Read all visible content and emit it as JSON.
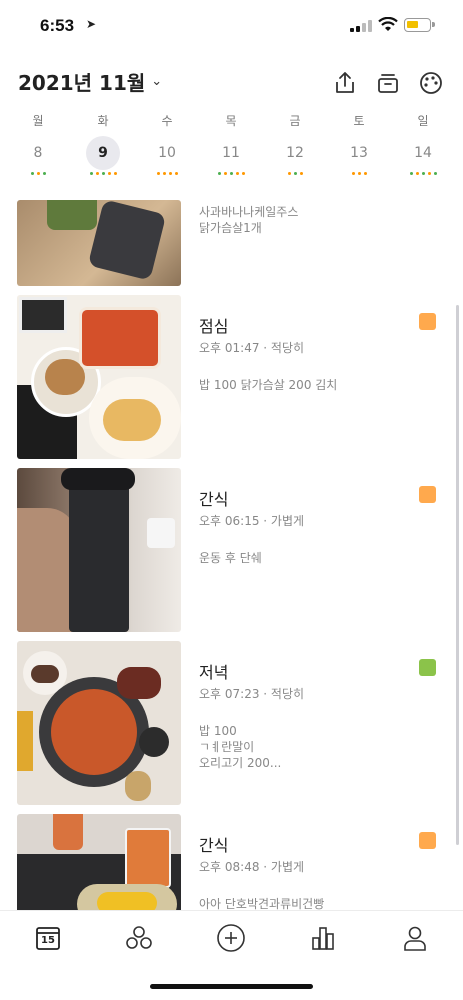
{
  "status_bar": {
    "time": "6:53",
    "battery_color": "#f2c000"
  },
  "header": {
    "month_label": "2021년 11월"
  },
  "week": [
    {
      "weekday": "월",
      "date": "8",
      "selected": false,
      "dots": [
        "#4caf50",
        "#ff9800",
        "#4caf50"
      ]
    },
    {
      "weekday": "화",
      "date": "9",
      "selected": true,
      "dots": [
        "#4caf50",
        "#ff9800",
        "#4caf50",
        "#ff9800",
        "#ff9800"
      ]
    },
    {
      "weekday": "수",
      "date": "10",
      "selected": false,
      "dots": [
        "#ff9800",
        "#ff9800",
        "#ff9800",
        "#ff9800"
      ]
    },
    {
      "weekday": "목",
      "date": "11",
      "selected": false,
      "dots": [
        "#4caf50",
        "#ff9800",
        "#4caf50",
        "#ff9800",
        "#ff9800"
      ]
    },
    {
      "weekday": "금",
      "date": "12",
      "selected": false,
      "dots": [
        "#ff9800",
        "#4caf50",
        "#ff9800"
      ]
    },
    {
      "weekday": "토",
      "date": "13",
      "selected": false,
      "dots": [
        "#ff9800",
        "#ff9800",
        "#ff9800"
      ]
    },
    {
      "weekday": "일",
      "date": "14",
      "selected": false,
      "dots": [
        "#4caf50",
        "#ff9800",
        "#4caf50",
        "#ff9800",
        "#4caf50"
      ]
    }
  ],
  "meals": {
    "first": {
      "note_line1": "사과바나나케일주스",
      "note_line2": "닭가슴살1개"
    },
    "lunch": {
      "title": "점심",
      "sub": "오후 01:47 · 적당히",
      "note": "밥 100 닭가슴살 200 김치",
      "badge_color": "#ffa94d"
    },
    "snack1": {
      "title": "간식",
      "sub": "오후 06:15 · 가볍게",
      "note": "운동 후 단쉐",
      "badge_color": "#ffa94d"
    },
    "dinner": {
      "title": "저녁",
      "sub": "오후 07:23 · 적당히",
      "note_line1": "밥 100",
      "note_line2": "ㄱㅖ란말이",
      "note_line3": "오리고기 200...",
      "badge_color": "#8bc34a"
    },
    "snack2": {
      "title": "간식",
      "sub": "오후 08:48 · 가볍게",
      "note": "아아 단호박견과류비건빵",
      "badge_color": "#ffa94d"
    }
  },
  "tabbar": {
    "calendar_day": "15"
  }
}
